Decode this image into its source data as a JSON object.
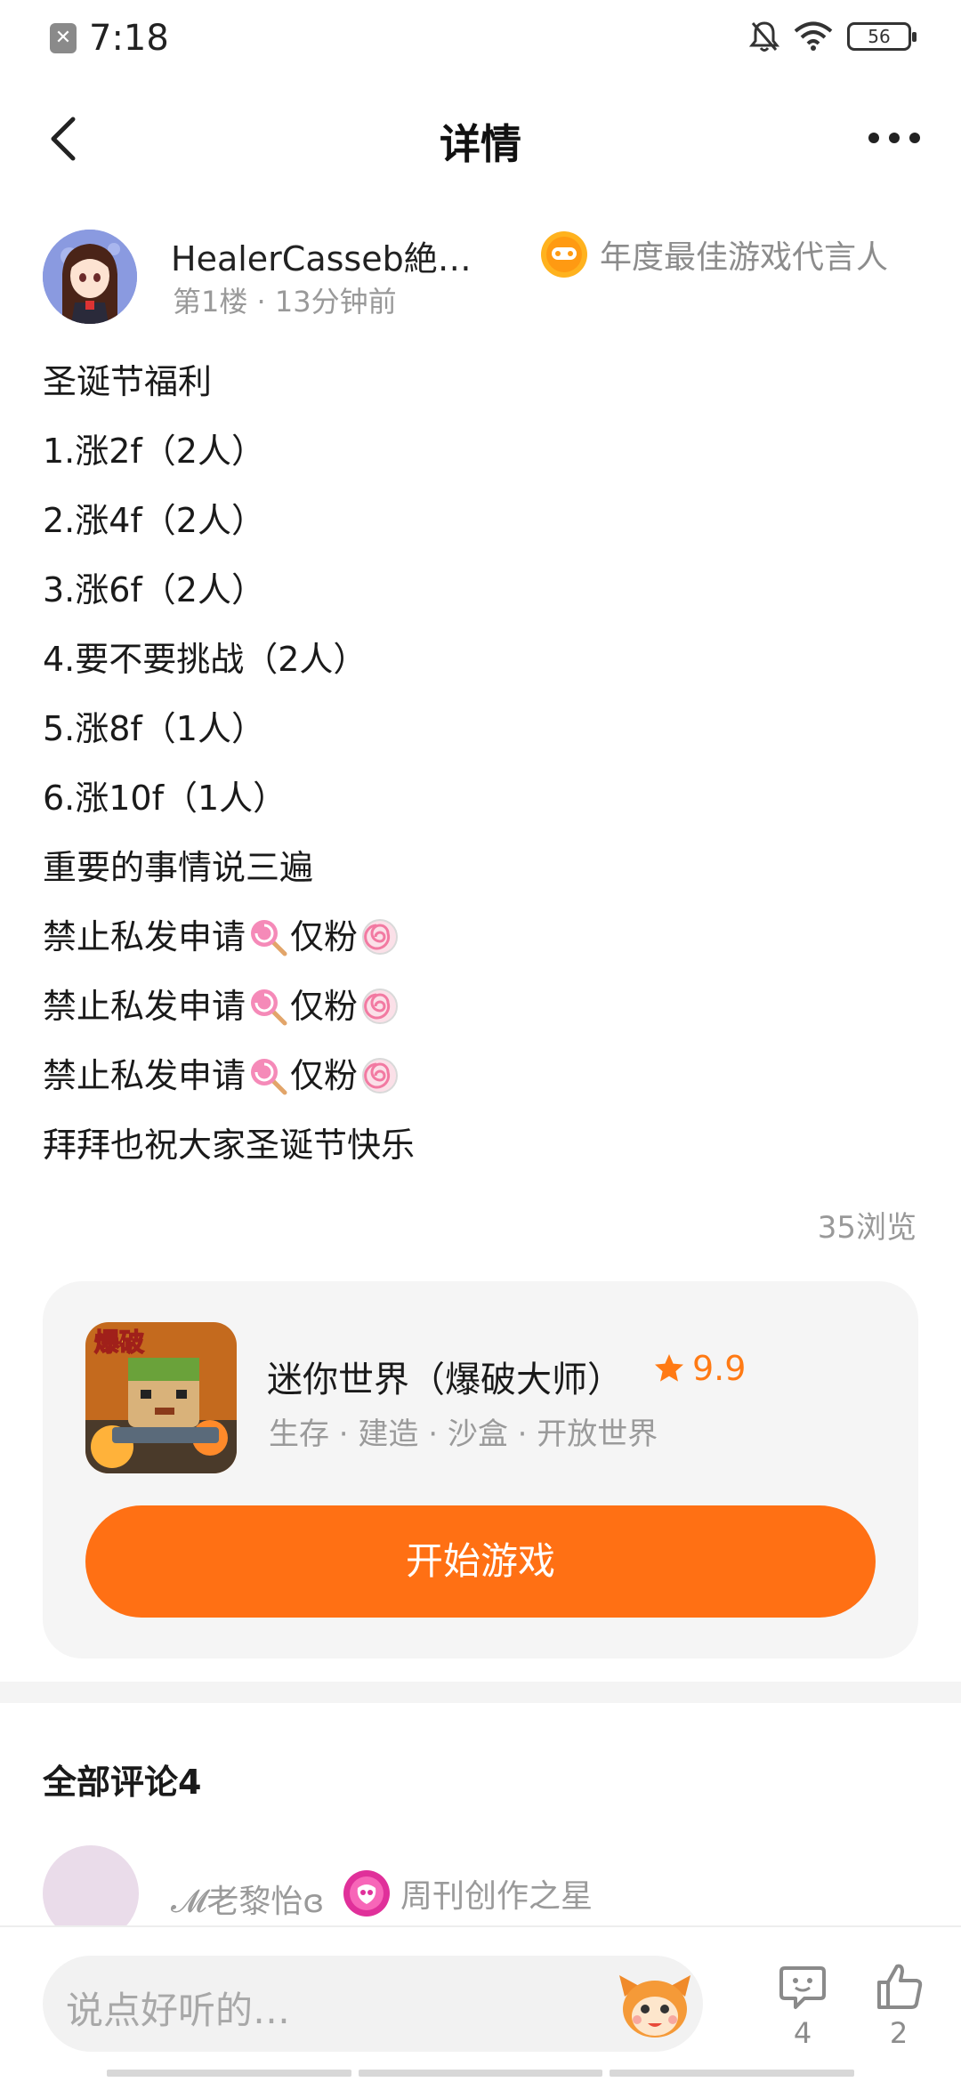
{
  "status_bar": {
    "time": "7:18",
    "battery": "56",
    "icons": [
      "notification-icon",
      "mute-icon",
      "wifi-icon",
      "battery-icon"
    ]
  },
  "header": {
    "title": "详情",
    "back_icon": "chevron-left-icon",
    "more_icon": "more-icon"
  },
  "author": {
    "name": "HealerCasseb絶…",
    "meta": "第1楼 · 13分钟前",
    "badge": "年度最佳游戏代言人"
  },
  "post": {
    "lines": [
      "圣诞节福利",
      "1.涨2f（2人）",
      "2.涨4f（2人）",
      "3.涨6f（2人）",
      "4.要不要挑战（2人）",
      "5.涨8f（1人）",
      "6.涨10f（1人）",
      "重要的事情说三遍"
    ],
    "repeat_prefix": "禁止私发申请",
    "repeat_suffix": "仅粉",
    "closing": "拜拜也祝大家圣诞节快乐",
    "views": "35浏览"
  },
  "game": {
    "name": "迷你世界（爆破大师）",
    "rating": "9.9",
    "tags": "生存 · 建造 · 沙盒 · 开放世界",
    "cover_text": "爆破",
    "button": "开始游戏"
  },
  "comments": {
    "title": "全部评论4",
    "first_user": "𝓜老黎怡ɞ",
    "first_user_badge": "周刊创作之星"
  },
  "bottom_bar": {
    "placeholder": "说点好听的…",
    "reply_count": "4",
    "like_count": "2"
  },
  "colors": {
    "accent": "#ff7014",
    "rating": "#ff7a14",
    "muted_text": "#999999",
    "card_bg": "#f5f5f5"
  }
}
